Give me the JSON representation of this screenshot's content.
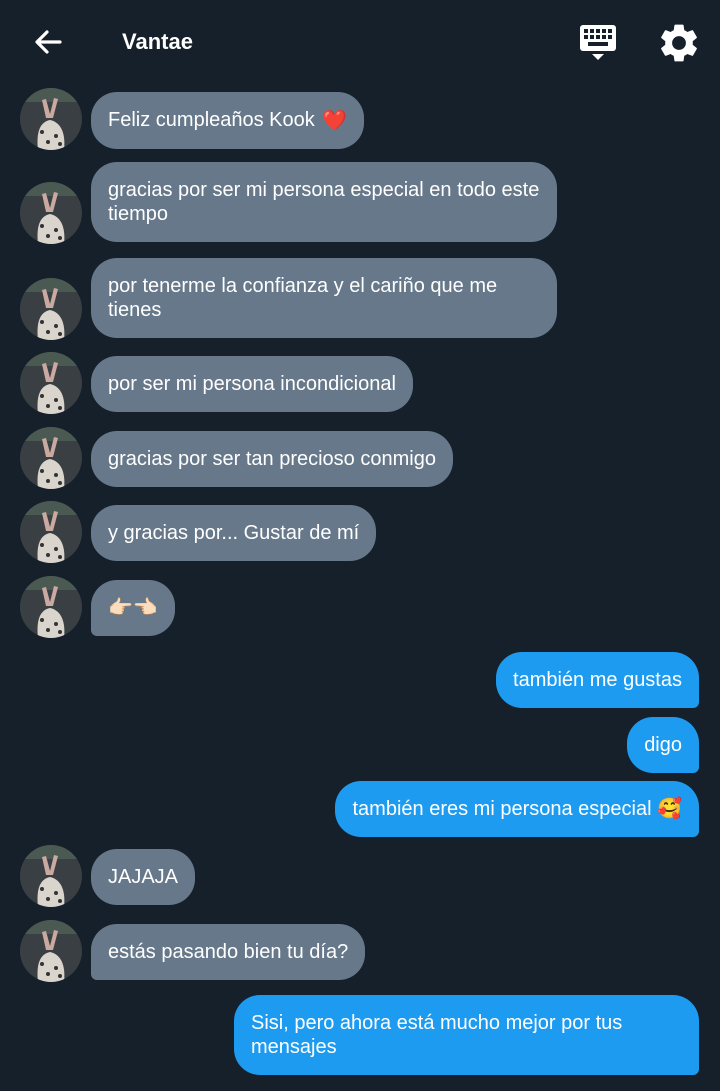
{
  "header": {
    "title": "Vantae",
    "back_icon": "arrow-left-icon",
    "keyboard_icon": "keyboard-icon",
    "settings_icon": "gear-icon"
  },
  "colors": {
    "background": "#15202b",
    "incoming_bubble": "#66788a",
    "outgoing_bubble": "#1d9bf0",
    "text": "#ffffff"
  },
  "messages": [
    {
      "from": "them",
      "text": "Feliz cumpleaños Kook",
      "emoji": "❤️"
    },
    {
      "from": "them",
      "text": "gracias por ser mi persona especial en todo este tiempo"
    },
    {
      "from": "them",
      "text": "por tenerme la confianza y el cariño que me tienes"
    },
    {
      "from": "them",
      "text": "por ser mi persona incondicional"
    },
    {
      "from": "them",
      "text": "gracias por ser tan precioso conmigo"
    },
    {
      "from": "them",
      "text": "y gracias por... Gustar de mí"
    },
    {
      "from": "them",
      "text": "👉🏻👈🏻"
    },
    {
      "from": "me",
      "text": "también me gustas"
    },
    {
      "from": "me",
      "text": "digo"
    },
    {
      "from": "me",
      "text": "también eres mi persona especial 🥰"
    },
    {
      "from": "them",
      "text": "JAJAJA"
    },
    {
      "from": "them",
      "text": "estás pasando bien tu día?"
    },
    {
      "from": "me",
      "text": "Sisi, pero ahora está mucho mejor por tus mensajes"
    }
  ]
}
